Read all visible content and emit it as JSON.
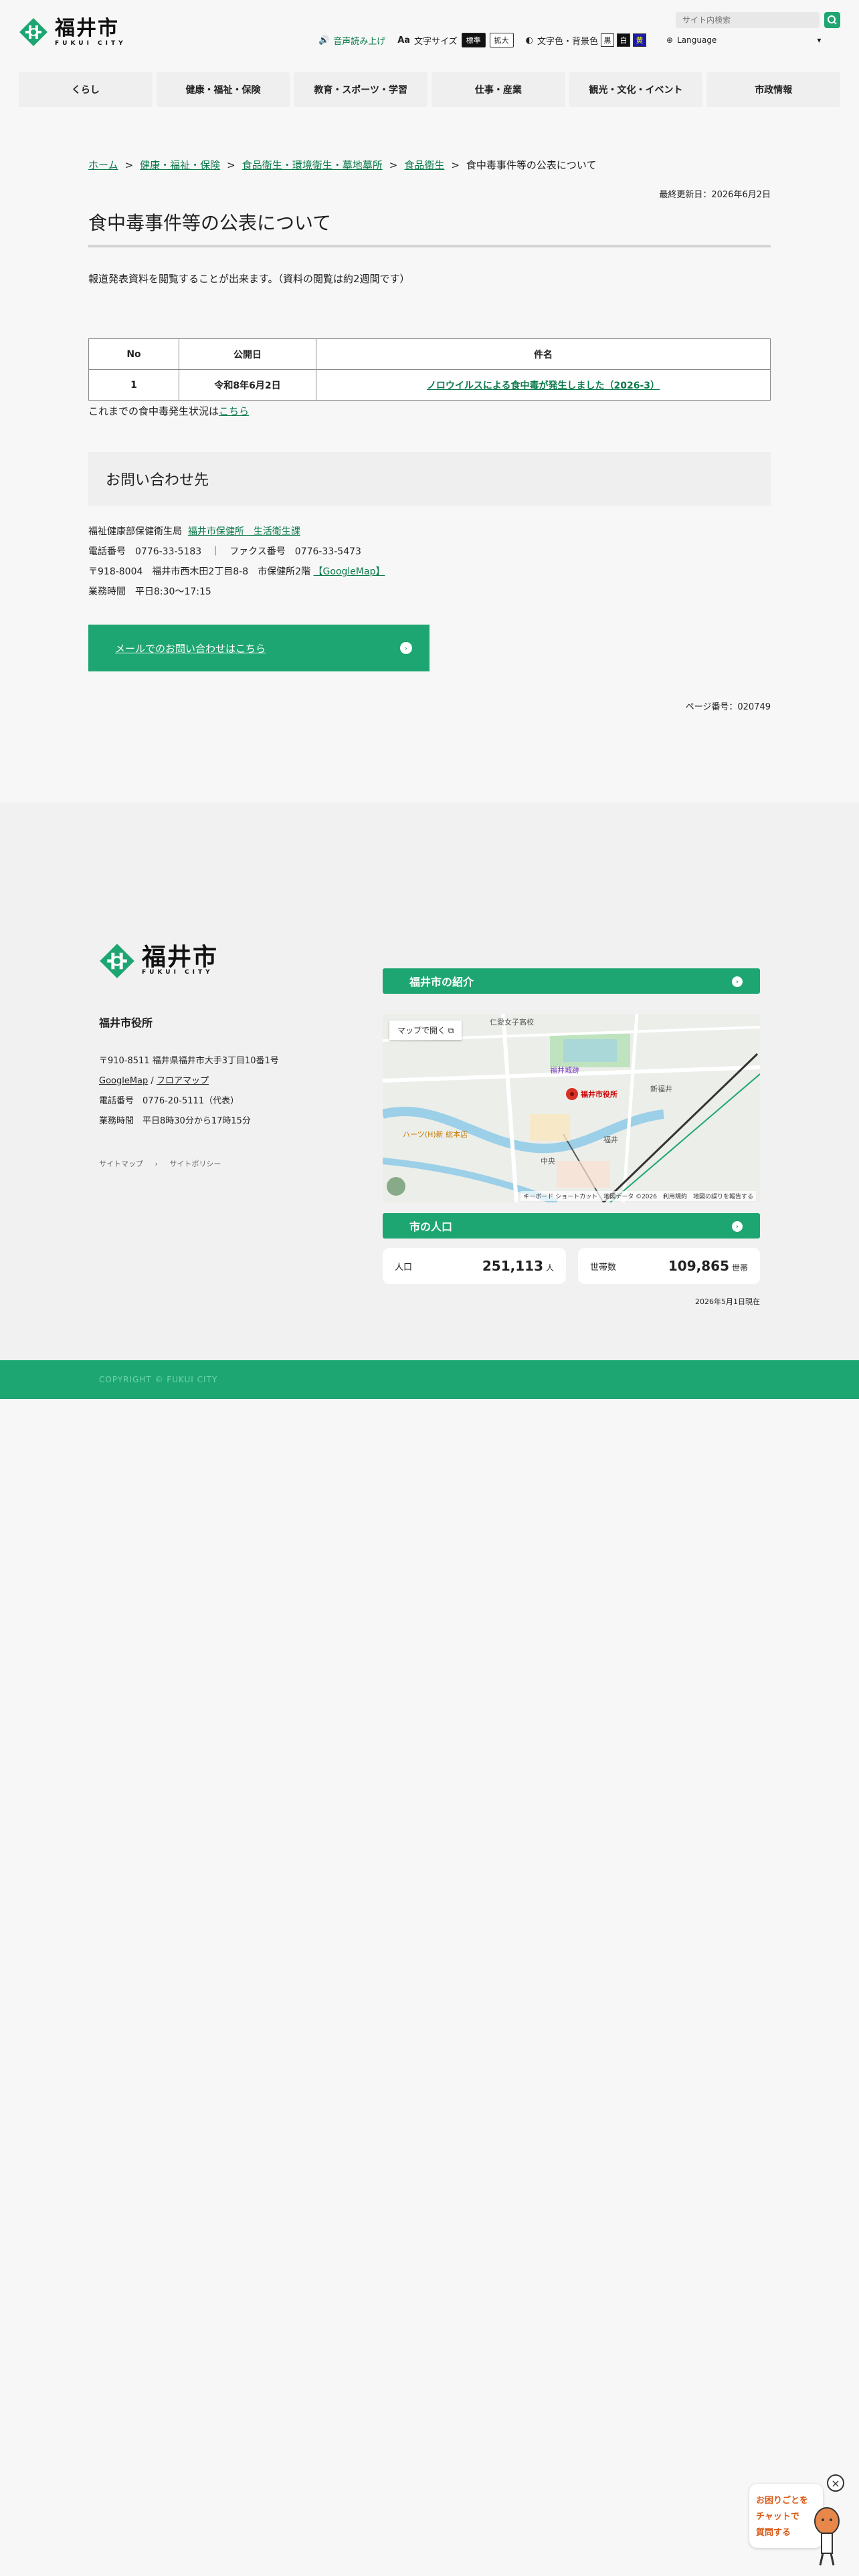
{
  "header": {
    "logo_jp": "福井市",
    "logo_en": "FUKUI CITY",
    "search_placeholder": "サイト内検索",
    "voice_label": "音声読み上げ",
    "font_size_label": "文字サイズ",
    "font_size_standard": "標準",
    "font_size_large": "拡大",
    "color_label": "文字色・背景色",
    "color_white": "黒",
    "color_black": "白",
    "color_navy": "黄",
    "language_label": "Language"
  },
  "gnav": [
    {
      "label": "くらし"
    },
    {
      "label": "健康・福祉・保険"
    },
    {
      "label": "教育・スポーツ・学習"
    },
    {
      "label": "仕事・産業"
    },
    {
      "label": "観光・文化・イベント"
    },
    {
      "label": "市政情報"
    }
  ],
  "breadcrumb": [
    {
      "label": "ホーム"
    },
    {
      "label": "健康・福祉・保険"
    },
    {
      "label": "食品衛生・環境衛生・墓地墓所"
    },
    {
      "label": "食品衛生"
    },
    {
      "label": "食中毒事件等の公表について"
    }
  ],
  "page": {
    "updated": "最終更新日：2026年6月2日",
    "title": "食中毒事件等の公表について",
    "lead": "報道発表資料を閲覧することが出来ます。（資料の閲覧は約2週間です）",
    "history_prefix": "これまでの食中毒発生状況は",
    "history_link": "こちら",
    "page_number": "ページ番号：020749"
  },
  "press_table": {
    "headers": [
      "No",
      "公開日",
      "件名"
    ],
    "rows": [
      {
        "no": "1",
        "date": "令和8年6月2日",
        "subject": "ノロウイルスによる食中毒が発生しました（2026-3）"
      }
    ]
  },
  "contact": {
    "heading": "お問い合わせ先",
    "dept_prefix": "福祉健康部保健衛生局",
    "dept_link": "福井市保健所　生活衛生課",
    "phone_line": "電話番号　0776-33-5183　｜　ファクス番号　0776-33-5473",
    "address_prefix": "〒918-8004　福井市西木田2丁目8-8　市保健所2階",
    "map_link": "【GoogleMap】",
    "hours": "業務時間　平日8:30～17:15",
    "mail_button": "メールでのお問い合わせはこちら"
  },
  "footer": {
    "office": "福井市役所",
    "address": "〒910-8511 福井県福井市大手3丁目10番1号",
    "map_link1": "GoogleMap",
    "map_sep": " / ",
    "map_link2": "フロアマップ",
    "phone": "電話番号　0776-20-5111（代表）",
    "hours": "業務時間　平日8時30分から17時15分",
    "link_sitemap": "サイトマップ",
    "link_policy": "サイトポリシー",
    "intro_heading": "福井市の紹介",
    "map_open": "マップで開く",
    "map_credit": "キーボード ショートカット　地図データ ©2026　利用規約　地図の誤りを報告する",
    "map_labels": [
      "仁愛女子高校",
      "福井城跡",
      "福井市役所",
      "新福井",
      "福井",
      "ハーツ(H)新 総本店",
      "中央"
    ],
    "population_heading": "市の人口",
    "population_label": "人口",
    "population_value": "251,113",
    "population_unit": "人",
    "households_label": "世帯数",
    "households_value": "109,865",
    "households_unit": "世帯",
    "population_date": "2026年5月1日現在",
    "copyright": "COPYRIGHT © FUKUI CITY"
  },
  "chatbot": {
    "line1": "お困りごとを",
    "line2": "チャットで",
    "line3": "質問する"
  }
}
